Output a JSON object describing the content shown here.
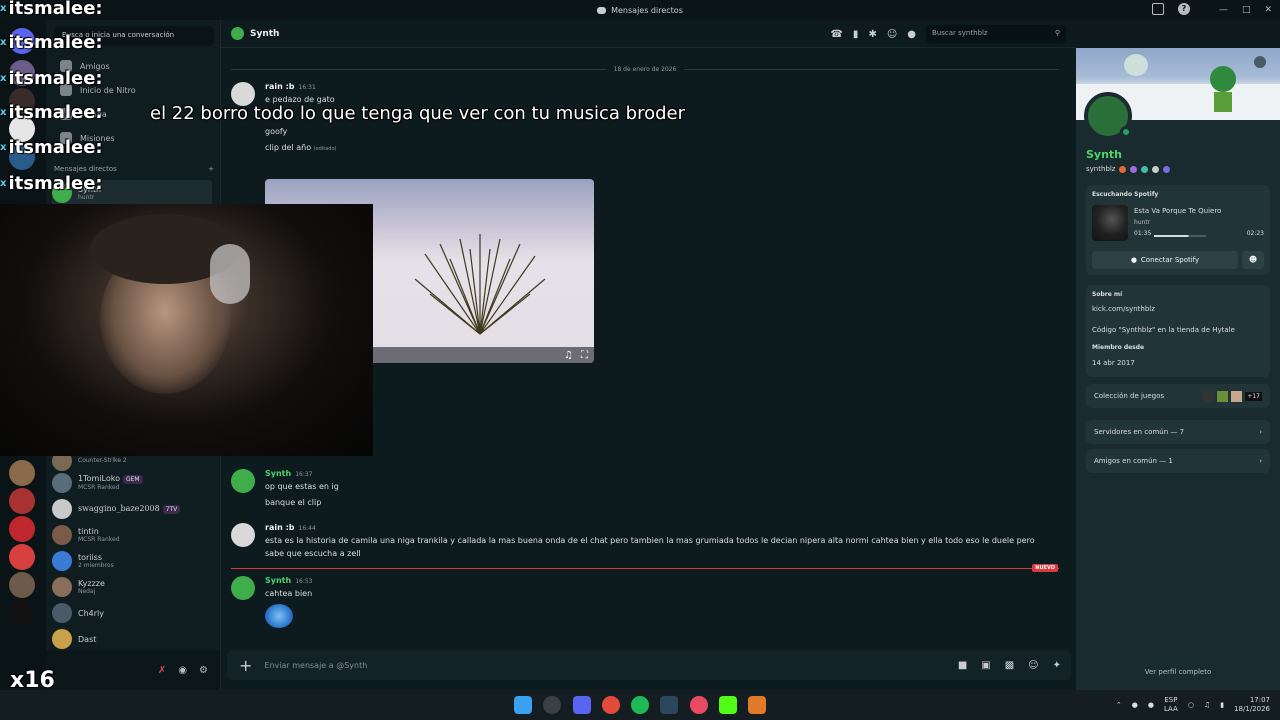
{
  "window": {
    "title": "Mensajes directos",
    "discord_icon": "discord-icon"
  },
  "sidebar": {
    "search_placeholder": "Busca o inicia una conversación",
    "nav": [
      {
        "label": "Amigos",
        "icon": "friends-icon"
      },
      {
        "label": "Inicio de Nitro",
        "icon": "nitro-icon"
      },
      {
        "label": "Tienda",
        "icon": "shop-icon"
      },
      {
        "label": "Misiones",
        "icon": "quests-icon"
      }
    ],
    "dm_header": "Mensajes directos",
    "dm_add": "+",
    "dms": [
      {
        "name": "Synth",
        "sub": "huntr",
        "avatar_color": "#3fae4a"
      },
      {
        "name": "",
        "sub": "Counter-Strike 2",
        "avatar_color": "#7a6a55"
      },
      {
        "name": "1TomiLoko",
        "badge": "GEM",
        "sub": "MCSR Ranked",
        "avatar_color": "#5a6c7a"
      },
      {
        "name": "swaggino_baze2008",
        "badge": "7TV",
        "sub": "",
        "avatar_color": "#c9c9c9"
      },
      {
        "name": "tintin",
        "sub": "MCSR Ranked",
        "avatar_color": "#7a5a48"
      },
      {
        "name": "toriiss",
        "sub": "2 miembros",
        "avatar_color": "#3a7bd5"
      },
      {
        "name": "Kyzzze",
        "sub": "Nedaj",
        "avatar_color": "#8a6e5a"
      },
      {
        "name": "Ch4rly",
        "sub": "",
        "avatar_color": "#4a5a66"
      },
      {
        "name": "Dast",
        "sub": "",
        "avatar_color": "#c8a24a"
      }
    ]
  },
  "chat": {
    "channel_name": "Synth",
    "search_placeholder": "Buscar synthblz",
    "date_divider": "18 de enero de 2026",
    "messages": [
      {
        "author": "rain :b",
        "time": "16:31",
        "lines": [
          "e pedazo de gato",
          "goofy",
          "clip del año"
        ],
        "edited": "(editado)"
      },
      {
        "author": "Synth",
        "time": "16:37",
        "lines": [
          "op que estas en ig",
          "banque el clip"
        ]
      },
      {
        "author": "rain :b",
        "time": "16:44",
        "lines": [
          "esta es la historia de camila una niga trankila y callada la mas buena onda de el chat pero tambien la mas grumiada todos le decian nipera alta normi cahtea bien y ella todo eso le duele pero",
          "sabe que escucha a zell"
        ]
      },
      {
        "author": "Synth",
        "time": "16:53",
        "lines": [
          "cahtea bien"
        ]
      }
    ],
    "new_label": "NUEVO",
    "composer_placeholder": "Enviar mensaje a @Synth"
  },
  "profile": {
    "display_name": "Synth",
    "username": "synthblz",
    "spotify": {
      "header": "Escuchando Spotify",
      "song": "Esta Va Porque Te Quiero",
      "artist": "huntr",
      "elapsed": "01:35",
      "duration": "02:23",
      "progress": 0.66,
      "connect_label": "Conectar Spotify"
    },
    "about_label": "Sobre mí",
    "about_lines": [
      "kick.com/synthblz",
      "Código \"Synthblz\" en la tienda de Hytale"
    ],
    "member_since_label": "Miembro desde",
    "member_since": "14 abr 2017",
    "games_label": "Colección de juegos",
    "games_more": "+17",
    "mutual_servers": "Servidores en común — 7",
    "mutual_friends": "Amigos en común — 1",
    "view_full": "Ver perfil completo"
  },
  "overlay": {
    "chat_name": "itsmalee:",
    "chat_badge": "x",
    "chat_message": "el 22 borro todo lo que tenga que ver con tu musica broder",
    "corner_text": "x16"
  },
  "taskbar": {
    "lang_top": "ESP",
    "lang_bottom": "LAA",
    "time": "17:07",
    "date": "18/1/2026"
  },
  "colors": {
    "accent_green": "#4fd36b",
    "danger": "#d83a42",
    "background": "#0d1b1e"
  }
}
